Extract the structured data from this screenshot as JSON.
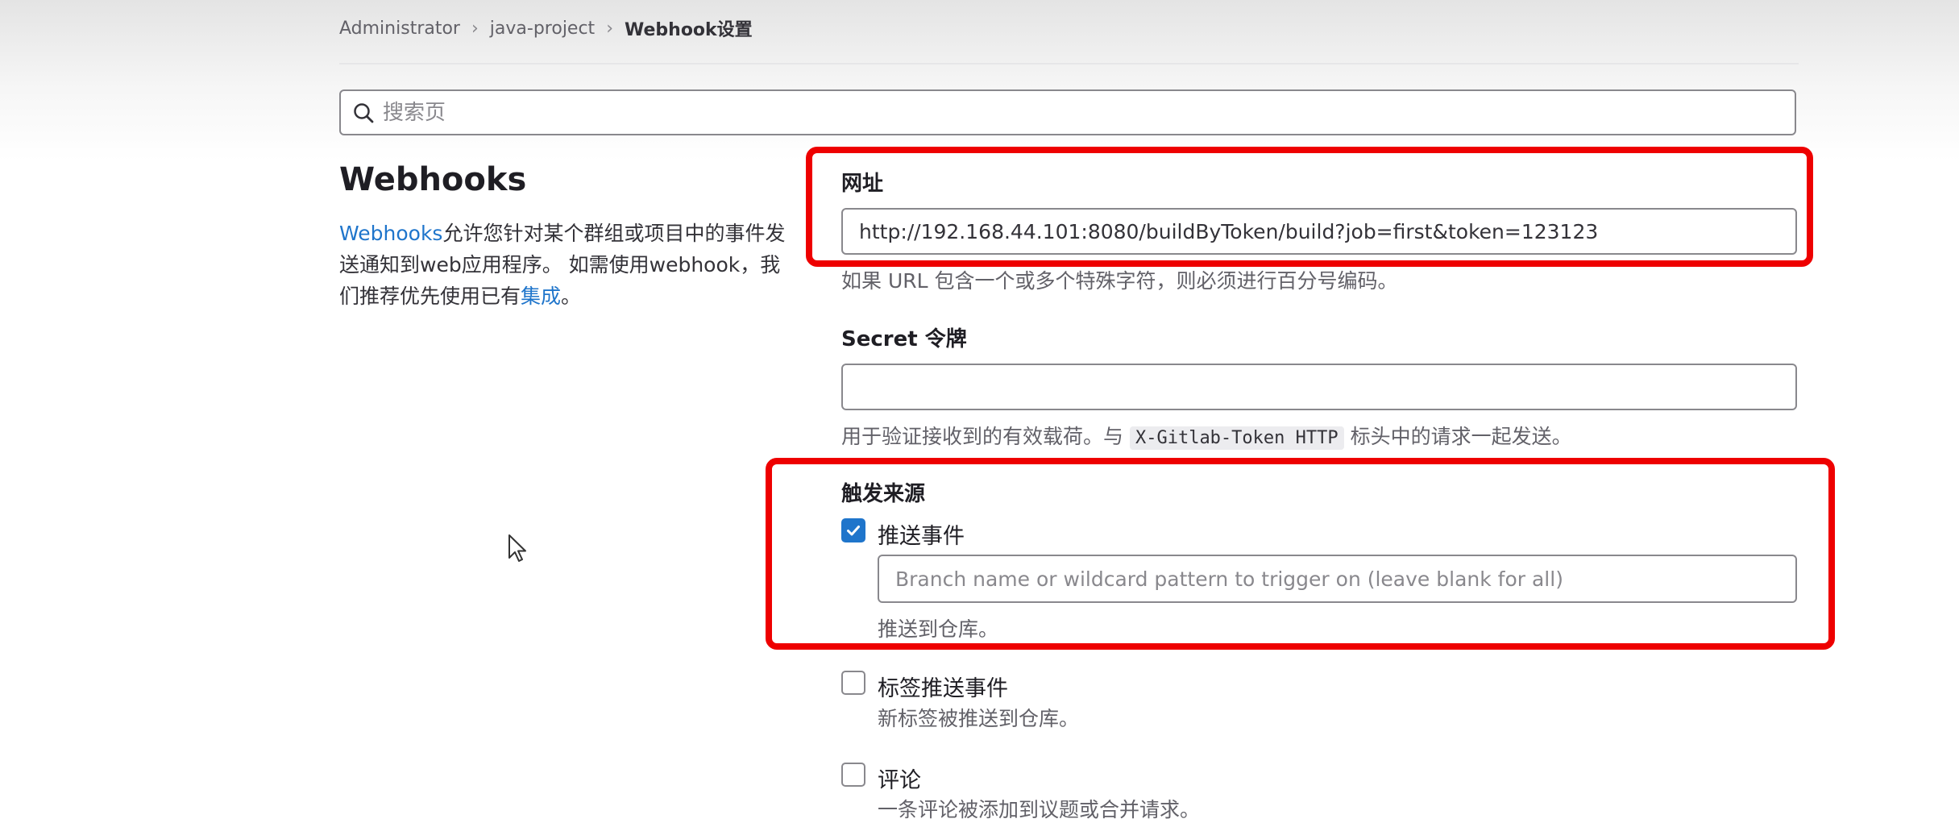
{
  "breadcrumb": [
    "Administrator",
    "java-project",
    "Webhook设置"
  ],
  "search": {
    "placeholder": "搜索页"
  },
  "left": {
    "title": "Webhooks",
    "desc_link": "Webhooks",
    "desc_text1": "允许您针对某个群组或项目中的事件发送通知到web应用程序。 如需使用webhook，我们推荐优先使用已有",
    "desc_link2": "集成",
    "desc_text2": "。"
  },
  "url": {
    "label": "网址",
    "value": "http://192.168.44.101:8080/buildByToken/build?job=first&token=123123",
    "help": "如果 URL 包含一个或多个特殊字符，则必须进行百分号编码。"
  },
  "secret": {
    "label": "Secret 令牌",
    "value": "",
    "help_prefix": "用于验证接收到的有效载荷。与",
    "help_code": "X-Gitlab-Token HTTP",
    "help_suffix": "标头中的请求一起发送。"
  },
  "trigger": {
    "label": "触发来源",
    "push": {
      "label": "推送事件",
      "checked": true,
      "branch_placeholder": "Branch name or wildcard pattern to trigger on (leave blank for all)",
      "help": "推送到仓库。"
    },
    "tag_push": {
      "label": "标签推送事件",
      "checked": false,
      "help": "新标签被推送到仓库。"
    },
    "comments": {
      "label": "评论",
      "checked": false,
      "help": "一条评论被添加到议题或合并请求。"
    }
  },
  "colors": {
    "highlight": "#ee0000",
    "accent": "#1f75cb"
  }
}
